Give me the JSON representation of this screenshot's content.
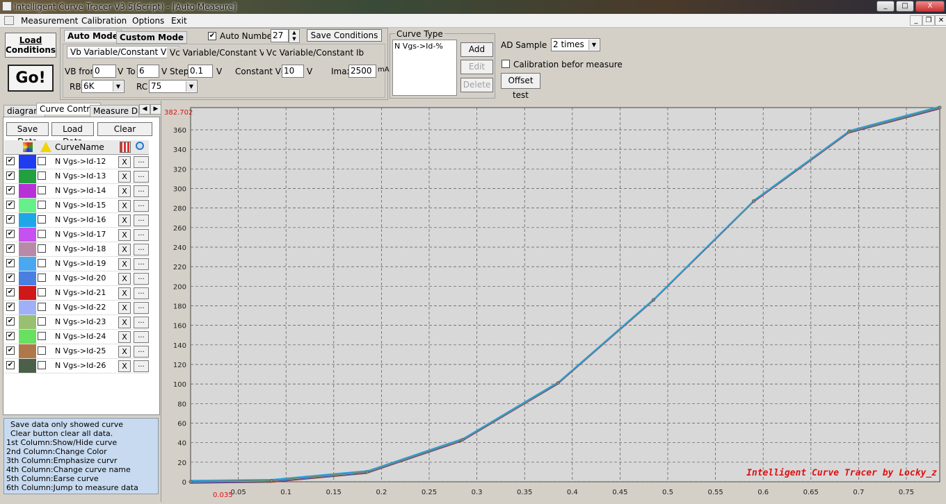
{
  "window": {
    "title": "Intelligent Curve Tracer V3.5(Script) - [Auto Measure]",
    "min": "_",
    "max": "□",
    "close": "X"
  },
  "menu": [
    "Measurement",
    "Calibration",
    "Options",
    "Exit"
  ],
  "mdi": {
    "min": "_",
    "restore": "❐",
    "close": "✕"
  },
  "toolbar": {
    "load_conditions": "Load\nConditions",
    "load_l1": "Load",
    "load_l2": "Conditions",
    "go": "Go!",
    "auto_mode": "Auto Mode",
    "custom_mode": "Custom Mode",
    "auto_number_label": "Auto Number",
    "auto_number_value": "27",
    "save_conditions": "Save Conditions",
    "tab_vb": "Vb Variable/Constant Vce",
    "tab_vc1": "Vc Variable/Constant Vb",
    "tab_vc2": "Vc Variable/Constant Ib",
    "vb_from_label": "VB from",
    "vb_from": "0",
    "v1": "V",
    "to_label": "To",
    "to": "6",
    "v2": "V",
    "step_label": "Step",
    "step": "0.1",
    "v3": "V",
    "const_vce_label": "Constant Vce",
    "const_vce": "10",
    "v4": "V",
    "imax_label": "Imax",
    "imax": "2500",
    "ma": "mA",
    "rb_label": "RB",
    "rb": "6K",
    "rc_label": "RC",
    "rc": "75",
    "curve_type_label": "Curve Type",
    "curve_type_item": "N Vgs->Id-%",
    "add": "Add",
    "edit": "Edit",
    "delete": "Delete",
    "ad_sample_label": "AD Sample",
    "ad_sample": "2 times",
    "calibration_label": "Calibration befor measure",
    "offset_test": "Offset test"
  },
  "left_tabs": [
    "diagram",
    "Curve Control",
    "Measure Data"
  ],
  "left_buttons": {
    "save": "Save Data",
    "load": "Load Data",
    "clear": "Clear"
  },
  "table_header": {
    "name": "CurveName"
  },
  "curves": [
    {
      "name": "N Vgs->Id-12",
      "color": "#1f3cf0"
    },
    {
      "name": "N Vgs->Id-13",
      "color": "#22a040"
    },
    {
      "name": "N Vgs->Id-14",
      "color": "#b830d8"
    },
    {
      "name": "N Vgs->Id-15",
      "color": "#66f08a"
    },
    {
      "name": "N Vgs->Id-16",
      "color": "#1fa6e8"
    },
    {
      "name": "N Vgs->Id-17",
      "color": "#c650f0"
    },
    {
      "name": "N Vgs->Id-18",
      "color": "#b88aa8"
    },
    {
      "name": "N Vgs->Id-19",
      "color": "#4aa8f0"
    },
    {
      "name": "N Vgs->Id-20",
      "color": "#4a7ee0"
    },
    {
      "name": "N Vgs->Id-21",
      "color": "#d01818"
    },
    {
      "name": "N Vgs->Id-22",
      "color": "#a0b0f8"
    },
    {
      "name": "N Vgs->Id-23",
      "color": "#98c070"
    },
    {
      "name": "N Vgs->Id-24",
      "color": "#68e060"
    },
    {
      "name": "N Vgs->Id-25",
      "color": "#b07848"
    },
    {
      "name": "N Vgs->Id-26",
      "color": "#4a6048"
    }
  ],
  "row_x": "X",
  "row_dots": "...",
  "info_lines": [
    "Save data only showed curve",
    "Clear button clear all data.",
    "1st Column:Show/Hide curve",
    "2nd Column:Change Color",
    "3th Column:Emphasize curvr",
    "4th Column:Change curve name",
    "5th Column:Earse curve",
    "6th Column:Jump to measure data"
  ],
  "chart_data": {
    "type": "line",
    "xlim": [
      0.0,
      0.785
    ],
    "ylim": [
      0,
      382.702
    ],
    "y_max_label": "382.702",
    "x_min_label": "0.035",
    "x_ticks": [
      "0.05",
      "0.1",
      "0.15",
      "0.2",
      "0.25",
      "0.3",
      "0.35",
      "0.4",
      "0.45",
      "0.5",
      "0.55",
      "0.6",
      "0.65",
      "0.7",
      "0.75"
    ],
    "y_ticks": [
      "0",
      "20",
      "40",
      "60",
      "80",
      "100",
      "120",
      "140",
      "160",
      "180",
      "200",
      "220",
      "240",
      "260",
      "280",
      "300",
      "320",
      "340",
      "360"
    ],
    "grid": true,
    "watermark": "Intelligent Curve Tracer by Locky_z",
    "x": [
      0.0,
      0.085,
      0.185,
      0.285,
      0.385,
      0.485,
      0.59,
      0.69,
      0.785
    ],
    "y": [
      0,
      1,
      10,
      43,
      101,
      186,
      287,
      358,
      382.7
    ],
    "series_colors": [
      "#d01818",
      "#22a040",
      "#1f3cf0",
      "#b830d8",
      "#66f08a",
      "#4a6048",
      "#b07848",
      "#1fa6e8"
    ]
  }
}
